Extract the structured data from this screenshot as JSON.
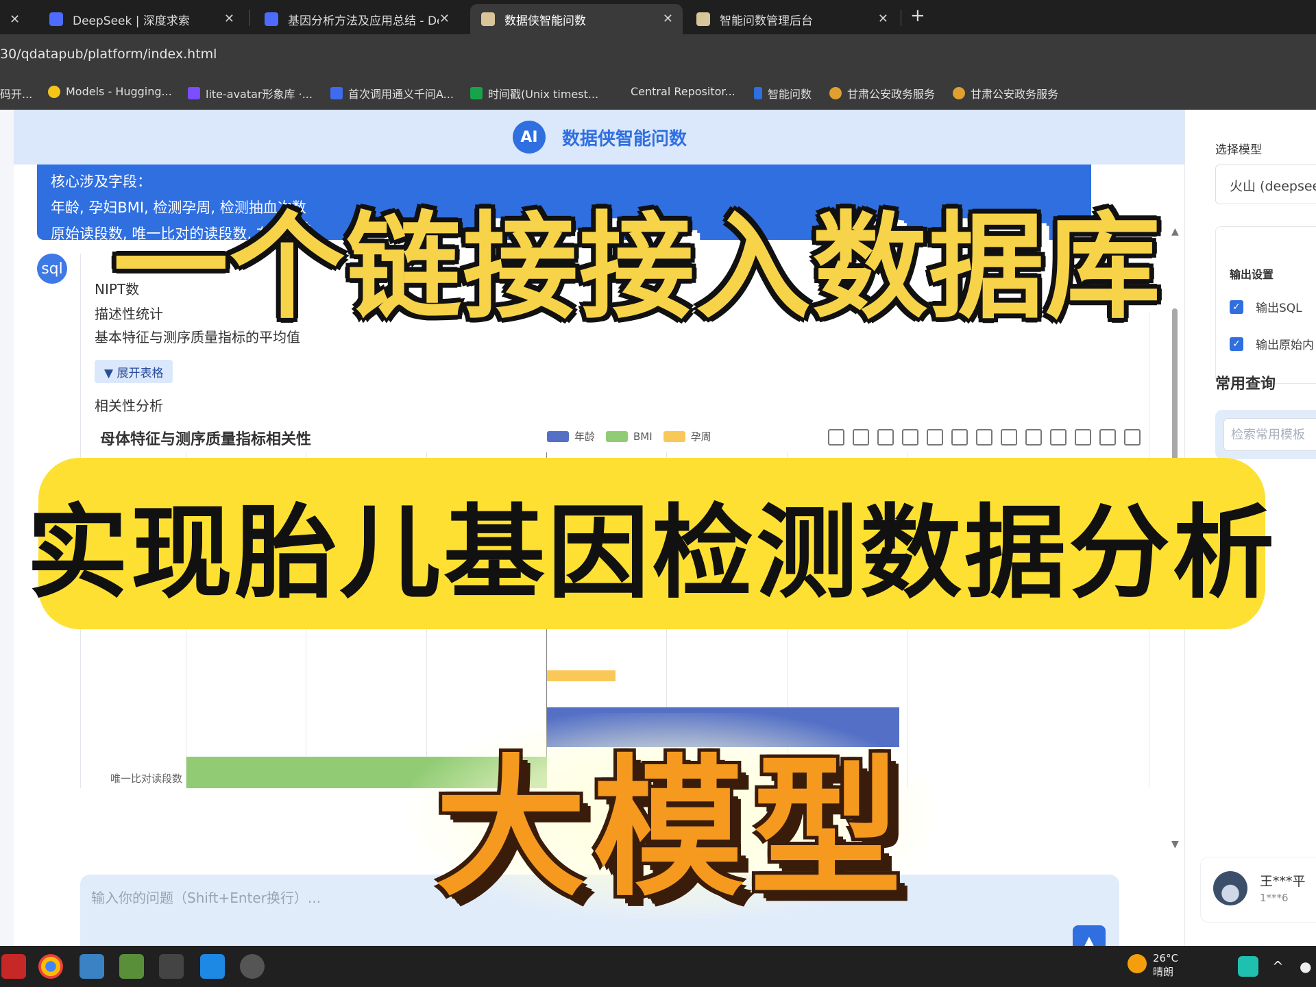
{
  "browser": {
    "tabs": [
      {
        "label": "DeepSeek | 深度求索",
        "active": false
      },
      {
        "label": "基因分析方法及应用总结 - Dee",
        "active": false
      },
      {
        "label": "数据侠智能问数",
        "active": true
      },
      {
        "label": "智能问数管理后台",
        "active": false
      }
    ],
    "url": "30/qdatapub/platform/index.html",
    "bookmarks": [
      "码开...",
      "Models - Hugging...",
      "lite-avatar形象库 ·...",
      "首次调用通义千问A...",
      "时间戳(Unix timest...",
      "Central Repositor...",
      "智能问数",
      "甘肃公安政务服务",
      "甘肃公安政务服务"
    ]
  },
  "app": {
    "logo": "AI",
    "title": "数据侠智能问数"
  },
  "chat": {
    "user_bubble_lines": [
      "核心涉及字段：",
      "年龄, 孕妇BMI, 检测孕周, 检测抽血次数",
      "原始读段数, 唯一比对的读段数, 在参"
    ],
    "sql_avatar": "sql",
    "answer_lines": {
      "title": "NIPT数",
      "desc_stats": "描述性统计",
      "desc_stats_sub": "基本特征与测序质量指标的平均值",
      "expand_btn": "▼ 展开表格",
      "corr": "相关性分析",
      "corr_sub": "母体特征与测序质量指标的相关性"
    }
  },
  "chart_data": {
    "type": "bar",
    "title": "母体特征与测序质量指标相关性",
    "legend_position": "top",
    "series": [
      {
        "name": "年龄",
        "color": "#5470c6"
      },
      {
        "name": "BMI",
        "color": "#91cc75"
      },
      {
        "name": "孕周",
        "color": "#fac858"
      }
    ],
    "visible_categories": [
      "唯一比对读段数"
    ],
    "orientation": "horizontal"
  },
  "input": {
    "placeholder": "输入你的问题（Shift+Enter换行）..."
  },
  "right_panel": {
    "select_model_label": "选择模型",
    "model_value": "火山 (deepseek",
    "output_settings_label": "输出设置",
    "output_sql": "输出SQL",
    "output_raw": "输出原始内",
    "common_query": "常用查询",
    "search_placeholder": "检索常用模板",
    "user_name": "王***平",
    "user_id": "1***6"
  },
  "taskbar": {
    "temp": "26°C",
    "weather": "晴朗"
  },
  "overlay": {
    "line1": "一个链接接入数据库",
    "line2": "实现胎儿基因检测数据分析",
    "line3": "大模型"
  },
  "colors": {
    "accent": "#2f6fe0",
    "header_bg": "#dbe8fb",
    "banner_yellow": "#fde032"
  }
}
